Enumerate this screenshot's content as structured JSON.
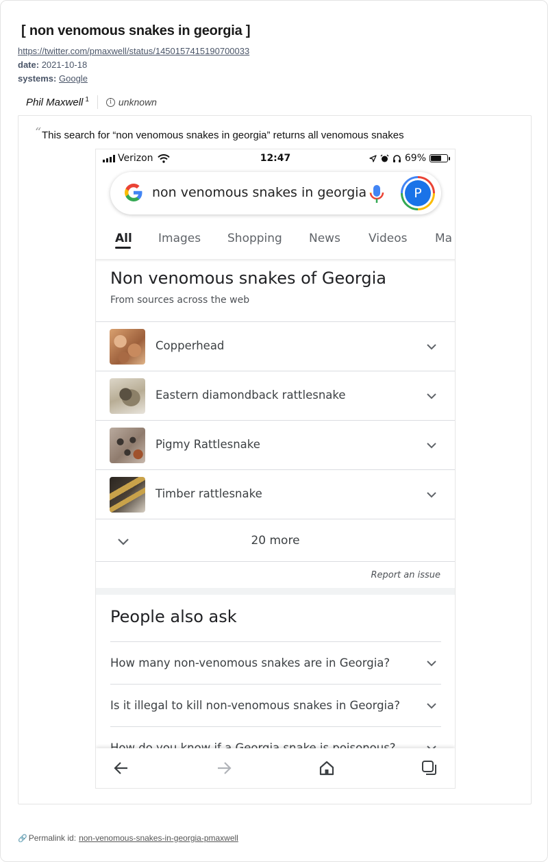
{
  "page": {
    "title": "[ non venomous snakes in georgia ]",
    "source_url": "https://twitter.com/pmaxwell/status/1450157415190700033",
    "date_label": "date:",
    "date_value": "2021-10-18",
    "systems_label": "systems:",
    "systems_value": "Google",
    "author_name": "Phil Maxwell",
    "author_sup": "1",
    "info_symbol": "i",
    "unknown_label": "unknown",
    "quote_open": "“",
    "quote_text": "This search for “non venomous snakes in georgia” returns all venomous snakes",
    "permalink_label": "Permalink id:",
    "permalink_value": "non-venomous-snakes-in-georgia-pmaxwell"
  },
  "phone": {
    "carrier": "Verizon",
    "time": "12:47",
    "battery": "69%",
    "query": "non venomous snakes in georgia",
    "avatar_letter": "P",
    "tabs": [
      "All",
      "Images",
      "Shopping",
      "News",
      "Videos",
      "Ma"
    ],
    "kp_title": "Non venomous snakes of Georgia",
    "kp_subtitle": "From sources across the web",
    "results": [
      {
        "label": "Copperhead"
      },
      {
        "label": "Eastern diamondback rattlesnake"
      },
      {
        "label": "Pigmy Rattlesnake"
      },
      {
        "label": "Timber rattlesnake"
      }
    ],
    "more_label": "20 more",
    "report_label": "Report an issue",
    "paa_title": "People also ask",
    "paa": [
      "How many non-venomous snakes are in Georgia?",
      "Is it illegal to kill non-venomous snakes in Georgia?",
      "How do you know if a Georgia snake is poisonous?"
    ]
  },
  "colors": {
    "google_blue": "#4285f4",
    "google_red": "#ea4335",
    "google_yellow": "#fbbc05",
    "google_green": "#34a853",
    "avatar_blue": "#1a73e8"
  }
}
